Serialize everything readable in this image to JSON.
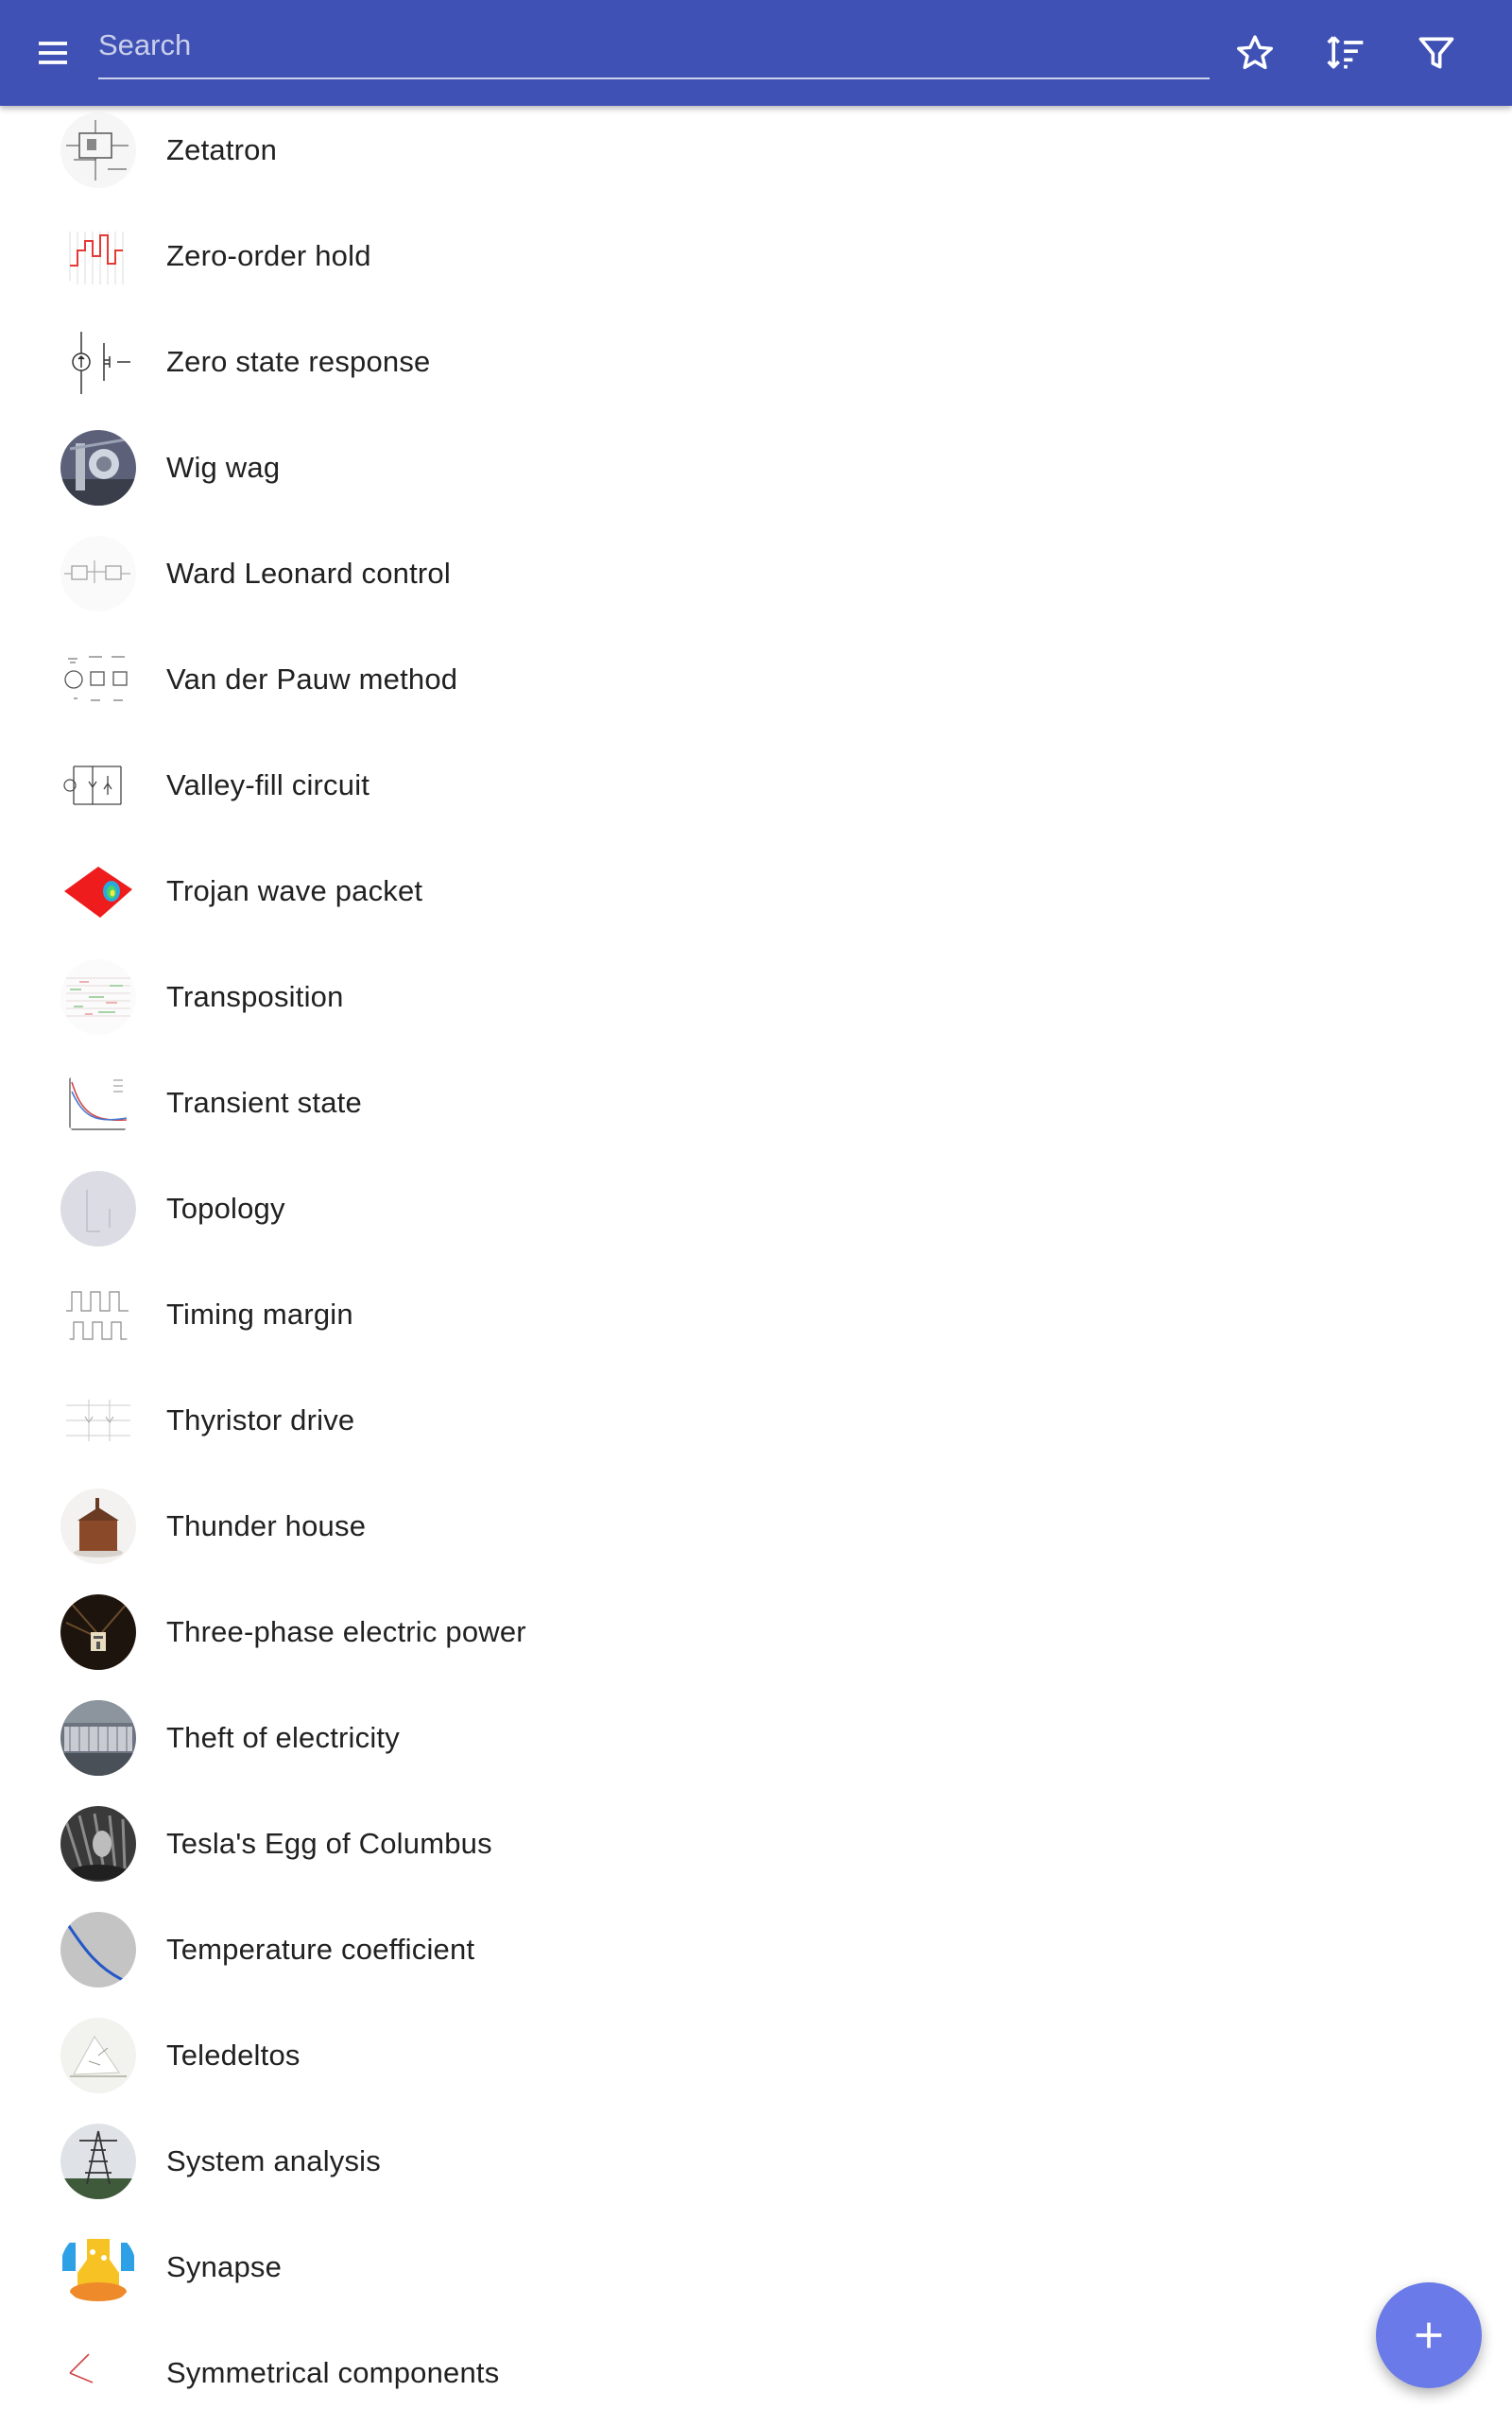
{
  "toolbar": {
    "menu_icon": "menu-icon",
    "search_placeholder": "Search",
    "search_value": "",
    "favorites_icon": "star-outline-icon",
    "sort_icon": "sort-icon",
    "filter_icon": "filter-icon"
  },
  "colors": {
    "app_bar": "#3f51b5",
    "fab": "#6a7ae8",
    "text": "#212121"
  },
  "items": [
    {
      "label": "Zetatron"
    },
    {
      "label": "Zero-order hold"
    },
    {
      "label": "Zero state response"
    },
    {
      "label": "Wig wag"
    },
    {
      "label": "Ward Leonard control"
    },
    {
      "label": "Van der Pauw method"
    },
    {
      "label": "Valley-fill circuit"
    },
    {
      "label": "Trojan wave packet"
    },
    {
      "label": "Transposition"
    },
    {
      "label": "Transient state"
    },
    {
      "label": "Topology"
    },
    {
      "label": "Timing margin"
    },
    {
      "label": "Thyristor drive"
    },
    {
      "label": "Thunder house"
    },
    {
      "label": "Three-phase electric power"
    },
    {
      "label": "Theft of electricity"
    },
    {
      "label": "Tesla's Egg of Columbus"
    },
    {
      "label": "Temperature coefficient"
    },
    {
      "label": "Teledeltos"
    },
    {
      "label": "System analysis"
    },
    {
      "label": "Synapse"
    },
    {
      "label": "Symmetrical components"
    }
  ],
  "fab": {
    "icon": "plus-icon"
  }
}
